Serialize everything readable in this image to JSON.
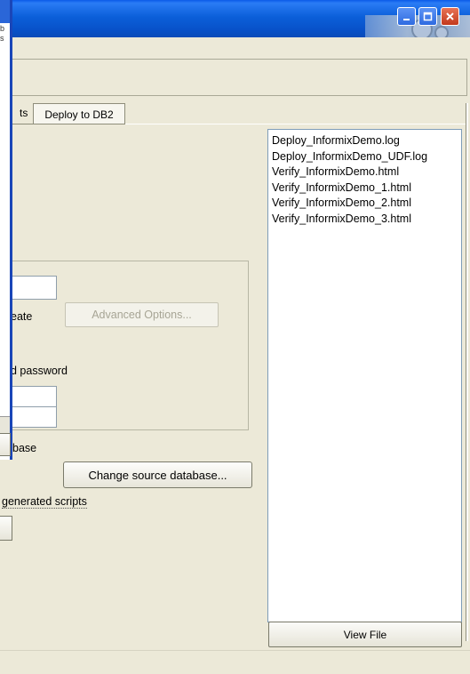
{
  "window": {
    "title": "",
    "buttons": {
      "minimize": "_",
      "maximize": "□",
      "close": "✕"
    }
  },
  "tabs": {
    "partial_label": "ts",
    "active_label": "Deploy to DB2"
  },
  "log_files": [
    "Deploy_InformixDemo.log",
    "Deploy_InformixDemo_UDF.log",
    "Verify_InformixDemo.html",
    "Verify_InformixDemo_1.html",
    "Verify_InformixDemo_2.html",
    "Verify_InformixDemo_3.html"
  ],
  "buttons": {
    "view_file": "View File",
    "advanced_options": "Advanced Options...",
    "change_source_db": "Change source database..."
  },
  "labels": {
    "create_partial": "eate",
    "password_partial": "d password",
    "database_partial": "base",
    "scripts_partial": "generated scripts"
  },
  "fields": {
    "field1_partial_value": ")"
  },
  "left_window": {
    "fragments": [
      "b",
      "s"
    ]
  },
  "colors": {
    "titlebar": "#0b5fd9",
    "face": "#ece9d8",
    "frame_blue": "#1a46b8"
  },
  "icons": [
    "minimize-icon",
    "maximize-icon",
    "close-icon"
  ]
}
